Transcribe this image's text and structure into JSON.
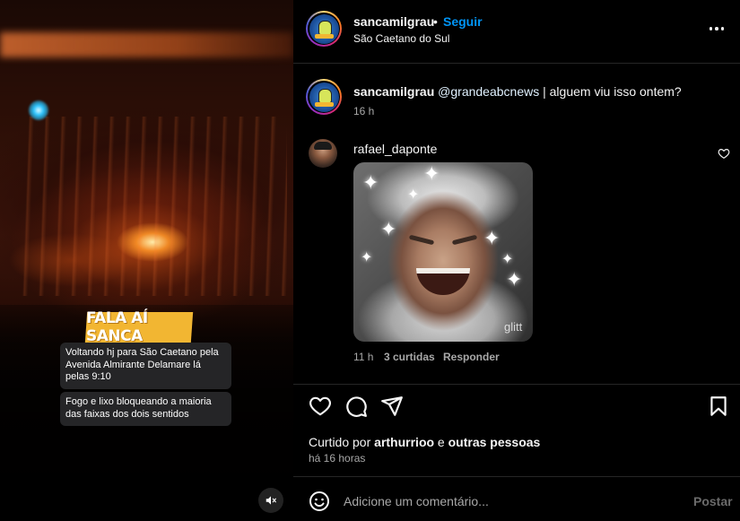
{
  "media": {
    "banner_text": "FALA AÍ SANCA",
    "caption_1": "Voltando hj para São Caetano pela Avenida Almirante Delamare lá pelas 9:10",
    "caption_2": "Fogo e lixo bloqueando a maioria das faixas dos dois sentidos",
    "mute_icon": "volume-muted-icon"
  },
  "header": {
    "username": "sancamilgrau",
    "separator": "•",
    "follow_label": "Seguir",
    "location": "São Caetano do Sul",
    "more_icon": "more-horizontal-icon"
  },
  "post_caption": {
    "username": "sancamilgrau",
    "mention": "@grandeabcnews",
    "text": " | alguem viu isso ontem?",
    "time": "16 h"
  },
  "comment": {
    "username": "rafael_daponte",
    "gif_watermark": "glitt",
    "time": "11 h",
    "likes": "3 curtidas",
    "reply_label": "Responder",
    "like_icon": "heart-icon"
  },
  "actions": {
    "icons": [
      "heart-icon",
      "comment-icon",
      "share-icon",
      "bookmark-icon"
    ]
  },
  "likes": {
    "prefix": "Curtido por ",
    "user": "arthurrioo",
    "middle": " e ",
    "others": "outras pessoas"
  },
  "post_date": "há 16 horas",
  "comment_box": {
    "placeholder": "Adicione um comentário...",
    "post_label": "Postar",
    "emoji_icon": "emoji-icon"
  },
  "colors": {
    "background": "#000000",
    "accent": "#0095f6",
    "banner": "#f2b632",
    "muted_text": "#a8a8a8"
  }
}
